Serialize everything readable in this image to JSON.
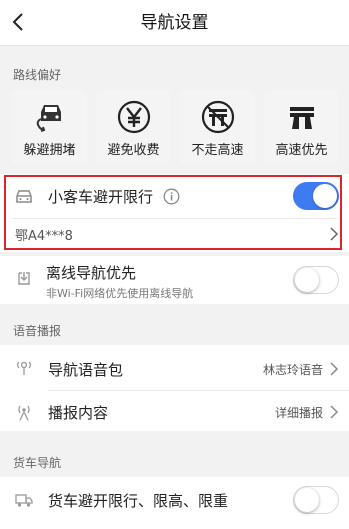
{
  "header": {
    "title": "导航设置"
  },
  "route_pref": {
    "section_title": "路线偏好",
    "options": [
      {
        "label": "躲避拥堵",
        "icon": "avoid-congestion-icon"
      },
      {
        "label": "避免收费",
        "icon": "avoid-toll-icon"
      },
      {
        "label": "不走高速",
        "icon": "no-highway-icon"
      },
      {
        "label": "高速优先",
        "icon": "highway-first-icon"
      }
    ]
  },
  "restriction": {
    "label": "小客车避开限行",
    "enabled": true,
    "plate": "鄂A4***8"
  },
  "offline": {
    "label": "离线导航优先",
    "subtitle": "非Wi-Fi网络优先使用离线导航",
    "enabled": false
  },
  "voice": {
    "section_title": "语音播报",
    "pack_label": "导航语音包",
    "pack_value": "林志玲语音",
    "content_label": "播报内容",
    "content_value": "详细播报"
  },
  "truck": {
    "section_title": "货车导航",
    "label": "货车避开限行、限高、限重",
    "enabled": false
  },
  "colors": {
    "accent": "#3e7bf0",
    "highlight_border": "#d9262c"
  }
}
